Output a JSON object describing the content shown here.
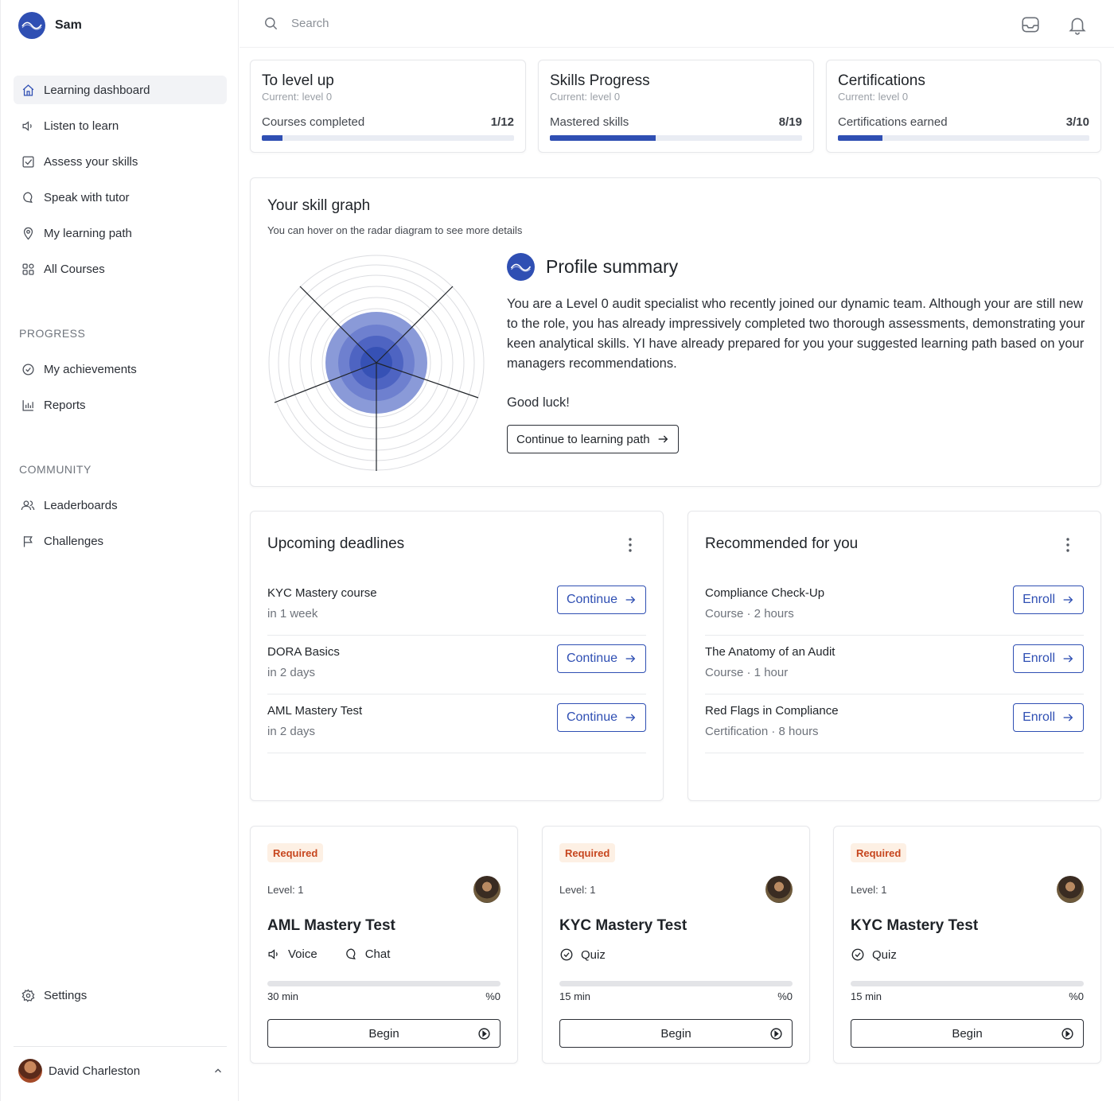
{
  "app": {
    "user_short": "Sam"
  },
  "sidebar": {
    "main_items": [
      {
        "label": "Learning dashboard",
        "icon": "home-icon"
      },
      {
        "label": "Listen to learn",
        "icon": "speaker-icon"
      },
      {
        "label": "Assess your skills",
        "icon": "checkbox-icon"
      },
      {
        "label": "Speak with tutor",
        "icon": "chat-icon"
      },
      {
        "label": "My learning path",
        "icon": "map-pin-icon"
      },
      {
        "label": "All Courses",
        "icon": "grid-icon"
      }
    ],
    "progress_heading": "PROGRESS",
    "progress_items": [
      {
        "label": "My achievements",
        "icon": "check-circle-icon"
      },
      {
        "label": "Reports",
        "icon": "bar-chart-icon"
      }
    ],
    "community_heading": "COMMUNITY",
    "community_items": [
      {
        "label": "Leaderboards",
        "icon": "users-icon"
      },
      {
        "label": "Challenges",
        "icon": "flag-icon"
      }
    ],
    "settings_label": "Settings",
    "user_name": "David Charleston"
  },
  "search": {
    "placeholder": "Search"
  },
  "stats": [
    {
      "title": "To level up",
      "subtitle": "Current: level 0",
      "label": "Courses completed",
      "value": "1/12",
      "progress": 0.0833
    },
    {
      "title": "Skills Progress",
      "subtitle": "Current: level 0",
      "label": "Mastered skills",
      "value": "8/19",
      "progress": 0.421
    },
    {
      "title": "Certifications",
      "subtitle": "Current: level 0",
      "label": "Certifications earned",
      "value": "3/10",
      "progress": 0.177
    }
  ],
  "skill_graph": {
    "title": "Your skill graph",
    "subtitle": "You can hover on the radar diagram to see more details",
    "summary_title": "Profile summary",
    "summary_text": "You are a Level 0 audit specialist who recently joined our dynamic team. Although your are still new to the role, you has already impressively completed two thorough assessments, demonstrating your keen analytical skills. YI have already prepared for you your suggested learning path based on your managers recommendations.",
    "summary_closing": "Good luck!",
    "cta_label": "Continue to learning path"
  },
  "deadlines": {
    "title": "Upcoming deadlines",
    "items": [
      {
        "title": "KYC Mastery course",
        "sub": "in 1 week",
        "action": "Continue"
      },
      {
        "title": "DORA Basics",
        "sub": "in 2 days",
        "action": "Continue"
      },
      {
        "title": "AML Mastery Test",
        "sub": "in 2 days",
        "action": "Continue"
      }
    ]
  },
  "recommended": {
    "title": "Recommended for you",
    "items": [
      {
        "title": "Compliance Check-Up",
        "sub": "Course · 2 hours",
        "action": "Enroll"
      },
      {
        "title": "The Anatomy of an Audit",
        "sub": "Course · 1 hour",
        "action": "Enroll"
      },
      {
        "title": "Red Flags in Compliance",
        "sub": "Certification · 8 hours",
        "action": "Enroll"
      }
    ]
  },
  "courses": [
    {
      "badge": "Required",
      "level": "Level: 1",
      "title": "AML Mastery Test",
      "tags": [
        {
          "label": "Voice",
          "icon": "speaker-icon"
        },
        {
          "label": "Chat",
          "icon": "chat-icon"
        }
      ],
      "time": "30 min",
      "percent": "%0",
      "progress": 0,
      "action": "Begin"
    },
    {
      "badge": "Required",
      "level": "Level: 1",
      "title": "KYC Mastery Test",
      "tags": [
        {
          "label": "Quiz",
          "icon": "check-circle-icon"
        }
      ],
      "time": "15 min",
      "percent": "%0",
      "progress": 0,
      "action": "Begin"
    },
    {
      "badge": "Required",
      "level": "Level: 1",
      "title": "KYC Mastery Test",
      "tags": [
        {
          "label": "Quiz",
          "icon": "check-circle-icon"
        }
      ],
      "time": "15 min",
      "percent": "%0",
      "progress": 0,
      "action": "Begin"
    }
  ],
  "colors": {
    "accent": "#2f4fb3",
    "badge_bg": "#fdf0e4",
    "badge_text": "#c7461e"
  }
}
